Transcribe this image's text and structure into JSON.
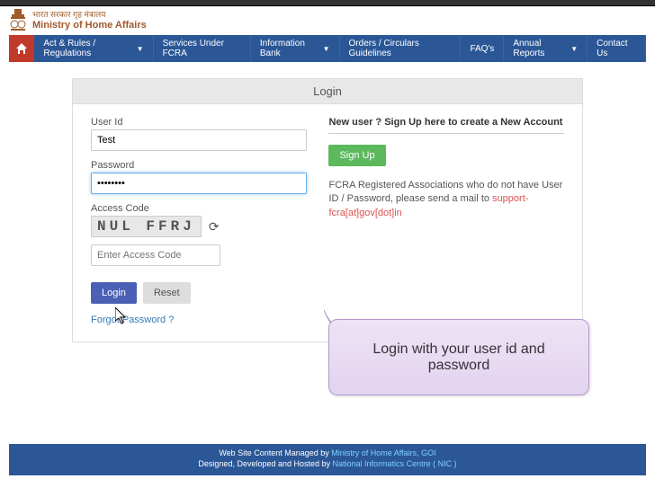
{
  "header": {
    "hindi": "भारत सरकार गृह मंत्रालय",
    "english": "Ministry of Home Affairs"
  },
  "nav": {
    "items": [
      {
        "label": "Act & Rules / Regulations",
        "dropdown": true
      },
      {
        "label": "Services Under FCRA",
        "dropdown": false
      },
      {
        "label": "Information Bank",
        "dropdown": true
      },
      {
        "label": "Orders / Circulars Guidelines",
        "dropdown": false
      },
      {
        "label": "FAQ's",
        "dropdown": false
      },
      {
        "label": "Annual Reports",
        "dropdown": true
      },
      {
        "label": "Contact Us",
        "dropdown": false
      }
    ]
  },
  "login": {
    "panel_title": "Login",
    "user_id_label": "User Id",
    "user_id_value": "Test",
    "password_label": "Password",
    "password_value": "••••••••",
    "access_code_label": "Access Code",
    "captcha_text": "NUL FFRJ",
    "access_code_placeholder": "Enter Access Code",
    "login_btn": "Login",
    "reset_btn": "Reset",
    "forgot": "Forgot Password ?"
  },
  "signup": {
    "heading": "New user ? Sign Up here to create a New Account",
    "button": "Sign Up",
    "info_prefix": "FCRA Registered Associations who do not have User ID / Password, please send a mail to ",
    "info_mail": "support-fcra[at]gov[dot]in"
  },
  "callout": {
    "text": "Login with your user id and password"
  },
  "footer": {
    "managed_prefix": "Web Site Content Managed by ",
    "managed_link": "Ministry of Home Affairs, GOI",
    "hosted_prefix": "Designed, Developed and Hosted by ",
    "hosted_link": "National Informatics Centre ( NIC )"
  }
}
